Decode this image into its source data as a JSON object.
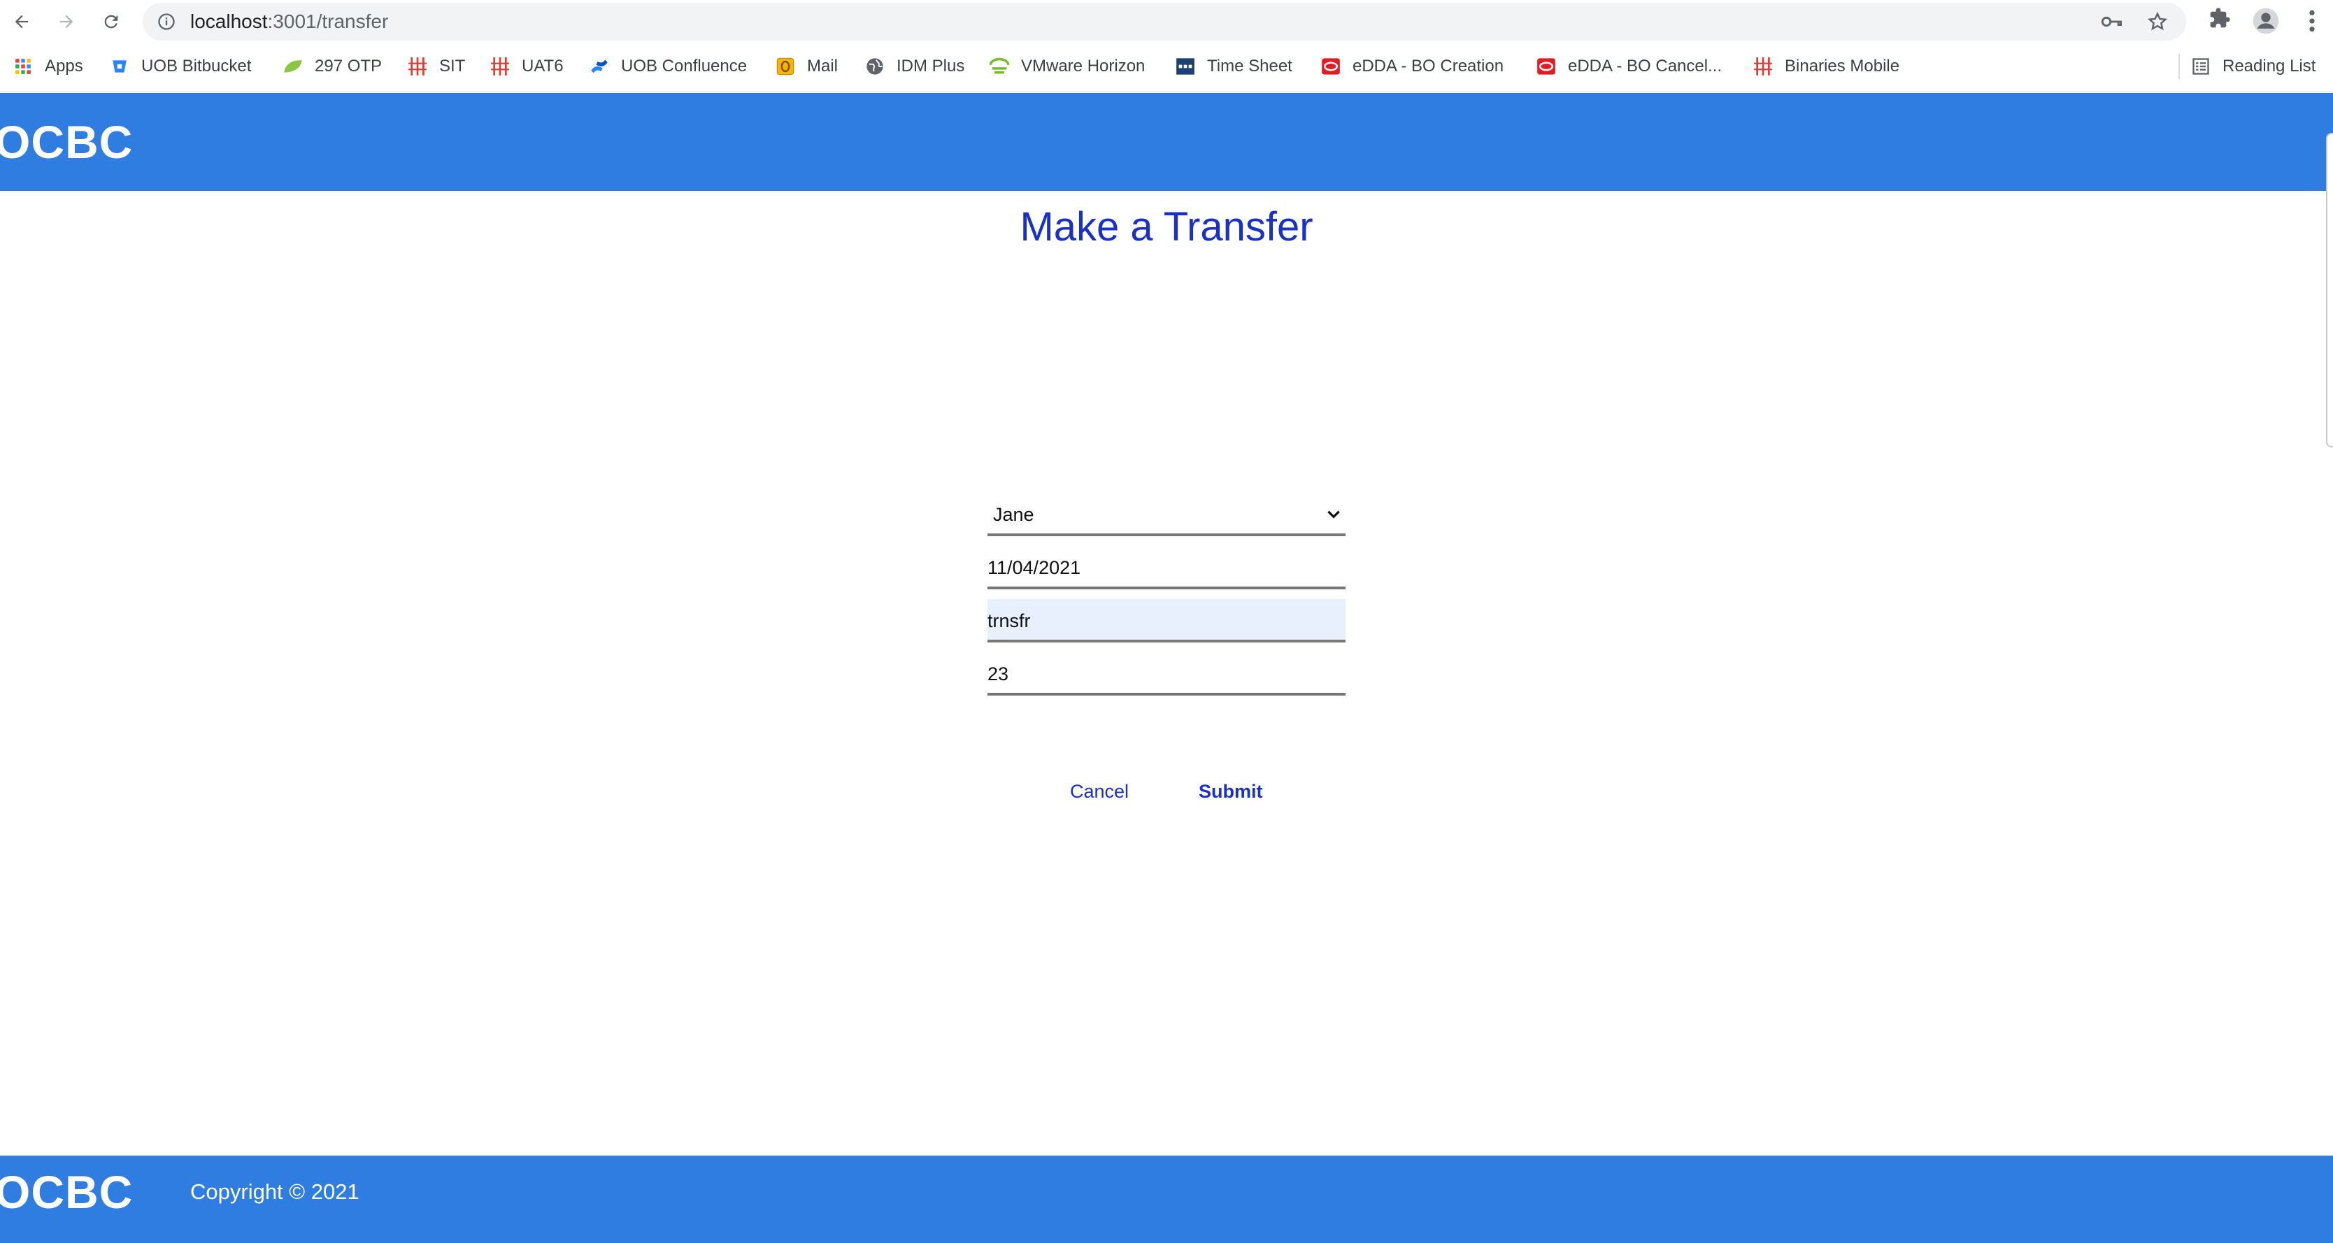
{
  "browser": {
    "url_host": "localhost",
    "url_path": ":3001/transfer",
    "bookmarks": [
      {
        "label": "Apps",
        "icon": "apps-grid-icon"
      },
      {
        "label": "UOB Bitbucket",
        "icon": "bitbucket-icon"
      },
      {
        "label": "297 OTP",
        "icon": "spring-leaf-icon"
      },
      {
        "label": "SIT",
        "icon": "red-bars-icon"
      },
      {
        "label": "UAT6",
        "icon": "red-bars-icon"
      },
      {
        "label": "UOB Confluence",
        "icon": "confluence-icon"
      },
      {
        "label": "Mail",
        "icon": "outlook-icon"
      },
      {
        "label": "IDM Plus",
        "icon": "globe-icon"
      },
      {
        "label": "VMware Horizon",
        "icon": "vmware-horizon-icon"
      },
      {
        "label": "Time Sheet",
        "icon": "ppm-icon"
      },
      {
        "label": "eDDA - BO Creation",
        "icon": "oracle-icon"
      },
      {
        "label": "eDDA - BO Cancel...",
        "icon": "oracle-icon"
      },
      {
        "label": "Binaries Mobile",
        "icon": "red-bars-icon"
      }
    ],
    "reading_list": "Reading List"
  },
  "site": {
    "logo": "OCBC",
    "title": "Make a Transfer",
    "copyright": "Copyright © 2021"
  },
  "form": {
    "payee": "Jane",
    "date": "11/04/2021",
    "description": "trnsfr",
    "amount": "23",
    "cancel_label": "Cancel",
    "submit_label": "Submit"
  },
  "colors": {
    "brand_blue": "#2f7de1",
    "title_blue": "#1a31c9"
  }
}
